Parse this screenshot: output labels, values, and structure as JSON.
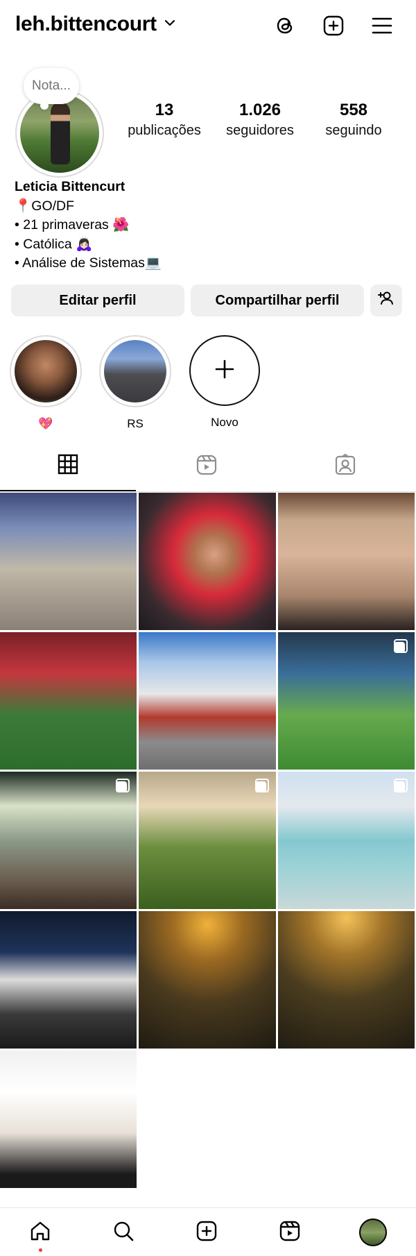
{
  "header": {
    "username": "leh.bittencourt",
    "icons": [
      "chevron-down-icon",
      "threads-icon",
      "create-post-icon",
      "menu-icon"
    ]
  },
  "note": {
    "text": "Nota..."
  },
  "stats": [
    {
      "value": "13",
      "label": "publicações"
    },
    {
      "value": "1.026",
      "label": "seguidores"
    },
    {
      "value": "558",
      "label": "seguindo"
    }
  ],
  "bio": {
    "name": "Leticia Bittencurt",
    "lines": [
      "📍GO/DF",
      "• 21 primaveras 🌺",
      "• Católica 🙇🏻‍♀️",
      "• Análise de Sistemas💻"
    ]
  },
  "buttons": {
    "edit": "Editar perfil",
    "share": "Compartilhar perfil"
  },
  "highlights": [
    {
      "label": "💖"
    },
    {
      "label": "RS"
    },
    {
      "label": "Novo"
    }
  ],
  "tabs": [
    "grid-icon",
    "reels-icon",
    "tagged-icon"
  ],
  "nav": [
    "home-icon",
    "search-icon",
    "create-icon",
    "reels-icon",
    "profile-avatar"
  ]
}
